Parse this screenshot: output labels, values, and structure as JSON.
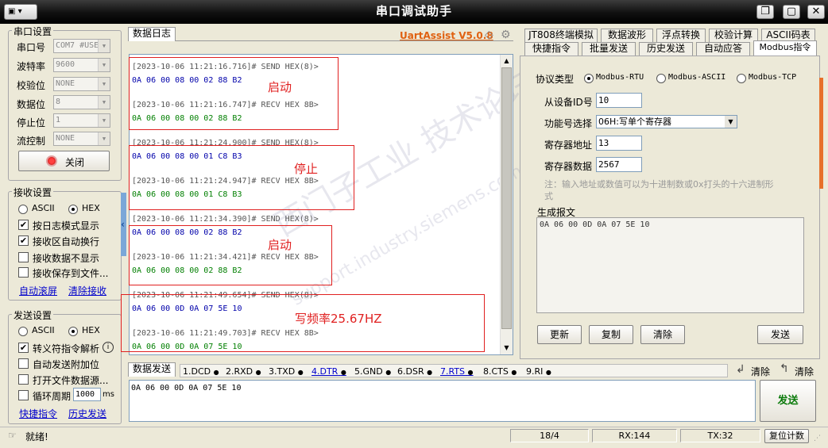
{
  "window": {
    "title": "串口调试助手",
    "sysmenu_label": "▣ ▾"
  },
  "serial": {
    "group_label": "串口设置",
    "port": {
      "label": "串口号",
      "value": "COM7 #USE"
    },
    "baud": {
      "label": "波特率",
      "value": "9600"
    },
    "parity": {
      "label": "校验位",
      "value": "NONE"
    },
    "databits": {
      "label": "数据位",
      "value": "8"
    },
    "stopbits": {
      "label": "停止位",
      "value": "1"
    },
    "flow": {
      "label": "流控制",
      "value": "NONE"
    },
    "close_button": "关闭"
  },
  "receive": {
    "group_label": "接收设置",
    "ascii": "ASCII",
    "hex": "HEX",
    "opt1": "按日志模式显示",
    "opt2": "接收区自动换行",
    "opt3": "接收数据不显示",
    "opt4": "接收保存到文件...",
    "link1": "自动滚屏",
    "link2": "清除接收"
  },
  "send": {
    "group_label": "发送设置",
    "ascii": "ASCII",
    "hex": "HEX",
    "opt1": "转义符指令解析",
    "opt2": "自动发送附加位",
    "opt3": "打开文件数据源...",
    "opt4": "循环周期",
    "period_value": "1000",
    "period_unit": "ms",
    "link1": "快捷指令",
    "link2": "历史发送"
  },
  "log": {
    "tab": "数据日志",
    "brand": "UartAssist V5.0.8",
    "lines": [
      "[2023-10-06 11:21:16.716]# SEND HEX(8)>",
      "0A 06 00 08 00 02 88 B2",
      "[2023-10-06 11:21:16.747]# RECV HEX 8B>",
      "0A 06 00 08 00 02 88 B2",
      "[2023-10-06 11:21:24.900]# SEND HEX(8)>",
      "0A 06 00 08 00 01 C8 B3",
      "[2023-10-06 11:21:24.947]# RECV HEX 8B>",
      "0A 06 00 08 00 01 C8 B3",
      "[2023-10-06 11:21:34.390]# SEND HEX(8)>",
      "0A 06 00 08 00 02 88 B2",
      "[2023-10-06 11:21:34.421]# RECV HEX 8B>",
      "0A 06 00 08 00 02 88 B2",
      "[2023-10-06 11:21:49.654]# SEND HEX(8)>",
      "0A 06 00 0D 0A 07 5E 10",
      "[2023-10-06 11:21:49.703]# RECV HEX 8B>",
      "0A 06 00 0D 0A 07 5E 10"
    ],
    "annotations": [
      "启动",
      "停止",
      "启动",
      "写频率25.67HZ"
    ],
    "watermark1": "西门子工业  技术论坛",
    "watermark2": "support.industry.siemens.com"
  },
  "right": {
    "tabs_row1": [
      "JT808终端模拟",
      "数据波形",
      "浮点转换",
      "校验计算",
      "ASCII码表"
    ],
    "tabs_row2": [
      "快捷指令",
      "批量发送",
      "历史发送",
      "自动应答",
      "Modbus指令"
    ],
    "protocol_label": "协议类型",
    "protocols": [
      "Modbus-RTU",
      "Modbus-ASCII",
      "Modbus-TCP"
    ],
    "slave_label": "从设备ID号",
    "slave_value": "10",
    "func_label": "功能号选择",
    "func_value": "06H:写单个寄存器",
    "reg_addr_label": "寄存器地址",
    "reg_addr_value": "13",
    "reg_data_label": "寄存器数据",
    "reg_data_value": "2567",
    "note_line1": "注：输入地址或数值可以为十进制数或0x打头的十六进制形",
    "note_line2": "式",
    "gen_label": "生成报文",
    "gen_value": "0A 06 00 0D 0A 07 5E 10",
    "btn_update": "更新",
    "btn_copy": "复制",
    "btn_clear": "清除",
    "btn_send": "发送"
  },
  "sendbar": {
    "tab": "数据发送",
    "signals": [
      "1.DCD",
      "2.RXD",
      "3.TXD",
      "4.DTR",
      "5.GND",
      "6.DSR",
      "7.RTS",
      "8.CTS",
      "9.RI"
    ],
    "clear1": "清除",
    "clear2": "清除",
    "send_text": "0A 06 00 0D 0A 07 5E 10",
    "send_button": "发送"
  },
  "status": {
    "ready": "就绪!",
    "pos": "18/4",
    "rx": "RX:144",
    "tx": "TX:32",
    "reset": "复位计数"
  }
}
